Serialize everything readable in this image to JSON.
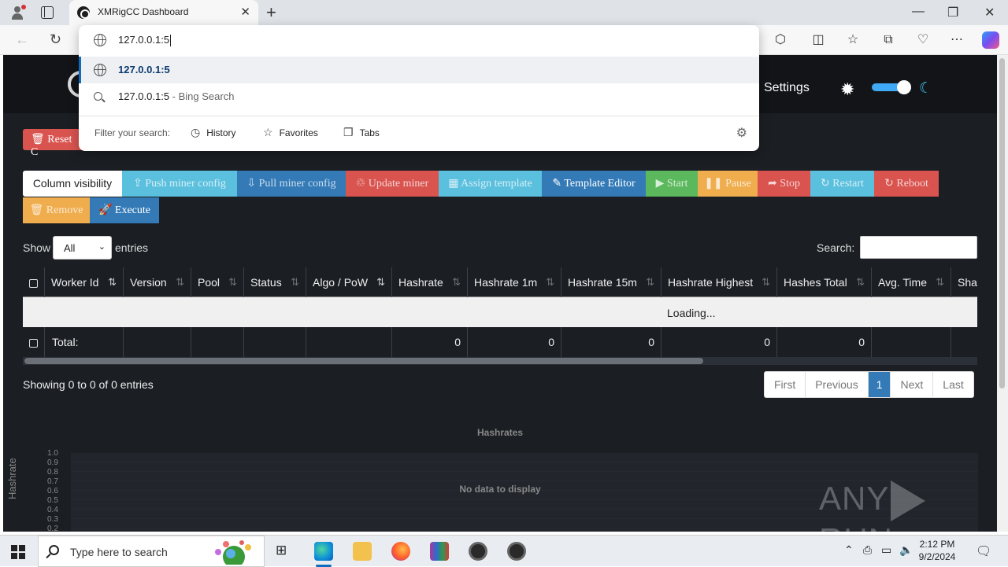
{
  "browser": {
    "tab_title": "XMRigCC Dashboard",
    "tab_close": "✕",
    "new_tab": "+",
    "window_controls": {
      "minimize": "—",
      "maximize": "❐",
      "close": "✕"
    },
    "nav": {
      "back": "←",
      "refresh": "↻"
    },
    "omnibox": {
      "typed_text": "127.0.0.1:5",
      "suggestion_url": "127.0.0.1:5",
      "suggestion_search": "127.0.0.1:5",
      "suggestion_search_suffix": " - Bing Search",
      "filter_label": "Filter your search:",
      "filters": [
        "History",
        "Favorites",
        "Tabs"
      ]
    },
    "toolbar_icons": [
      "extensions-icon",
      "split-screen-icon",
      "favorites-icon",
      "collections-icon",
      "performance-icon",
      "more-icon",
      "copilot-icon"
    ]
  },
  "dashboard": {
    "settings_label": "Settings",
    "reset_button": "Reset C",
    "buttons": [
      {
        "label": "Column visibility",
        "color": "#ffffff"
      },
      {
        "label": "⇪ Push miner config",
        "color": "#5bc0de"
      },
      {
        "label": "⇩ Pull miner config",
        "color": "#337ab7"
      },
      {
        "label": "♲ Update miner",
        "color": "#d9534f"
      },
      {
        "label": "▦ Assign template",
        "color": "#5bc0de"
      },
      {
        "label": "✎ Template Editor",
        "color": "#337ab7"
      },
      {
        "label": "▶ Start",
        "color": "#5cb85c"
      },
      {
        "label": "❚❚ Pause",
        "color": "#f0ad4e"
      },
      {
        "label": "➦ Stop",
        "color": "#d9534f"
      },
      {
        "label": "↻ Restart",
        "color": "#5bc0de"
      },
      {
        "label": "↻ Reboot",
        "color": "#d9534f"
      },
      {
        "label": "🗑 Remove",
        "color": "#f0ad4e"
      },
      {
        "label": "🚀 Execute",
        "color": "#337ab7"
      }
    ],
    "show_label": "Show",
    "entries_select": "All",
    "entries_label": "entries",
    "search_label": "Search:",
    "table": {
      "columns": [
        "Worker Id",
        "Version",
        "Pool",
        "Status",
        "Algo / PoW",
        "Hashrate",
        "Hashrate 1m",
        "Hashrate 15m",
        "Hashrate Highest",
        "Hashes Total",
        "Avg. Time",
        "Sha"
      ],
      "loading_text": "Loading...",
      "total_label": "Total:",
      "totals": [
        "0",
        "0",
        "0",
        "0",
        "0"
      ]
    },
    "info_text": "Showing 0 to 0 of 0 entries",
    "pagination": [
      "First",
      "Previous",
      "1",
      "Next",
      "Last"
    ],
    "chart": {
      "title": "Hashrates",
      "ylabel": "Hashrate",
      "y_ticks": [
        "1.0",
        "0.9",
        "0.8",
        "0.7",
        "0.6",
        "0.5",
        "0.4",
        "0.3",
        "0.2"
      ],
      "no_data": "No data to display"
    },
    "watermark": {
      "left": "ANY",
      "right": "RUN"
    }
  },
  "taskbar": {
    "search_placeholder": "Type here to search",
    "time": "2:12 PM",
    "date": "9/2/2024"
  }
}
